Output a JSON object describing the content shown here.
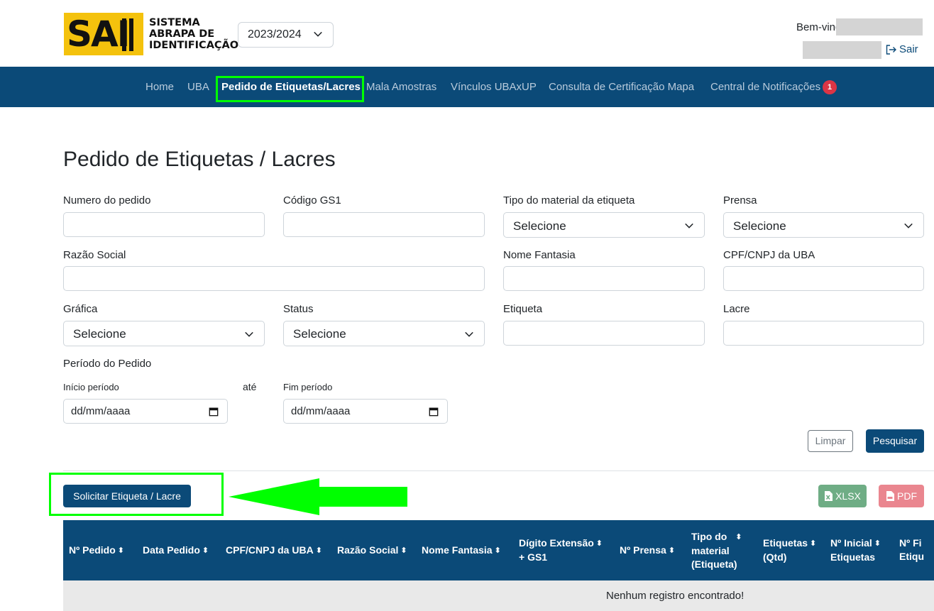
{
  "header": {
    "logo_letters": "SAI",
    "logo_line1": "SISTEMA",
    "logo_line2": "ABRAPA DE",
    "logo_line3": "IDENTIFICAÇÃO",
    "year_selected": "2023/2024",
    "welcome": "Bem-vindo",
    "logout": "Sair"
  },
  "nav": {
    "items": [
      "Home",
      "UBA",
      "Pedido de Etiquetas/Lacres",
      "Mala Amostras",
      "Vínculos UBAxUP",
      "Consulta de Certificação Mapa",
      "Central de Notificações"
    ],
    "notification_count": "1"
  },
  "page": {
    "title": "Pedido de Etiquetas / Lacres"
  },
  "form": {
    "numero_pedido": "Numero do pedido",
    "codigo_gs1": "Código GS1",
    "tipo_material": "Tipo do material da etiqueta",
    "prensa": "Prensa",
    "razao_social": "Razão Social",
    "nome_fantasia": "Nome Fantasia",
    "cpf_cnpj_uba": "CPF/CNPJ da UBA",
    "grafica": "Gráfica",
    "status": "Status",
    "etiqueta": "Etiqueta",
    "lacre": "Lacre",
    "periodo": "Período do Pedido",
    "inicio_periodo": "Início período",
    "ate": "até",
    "fim_periodo": "Fim período",
    "select_placeholder": "Selecione",
    "date_placeholder": "dd/mm/aaaa",
    "limpar": "Limpar",
    "pesquisar": "Pesquisar"
  },
  "actions": {
    "solicitar": "Solicitar Etiqueta / Lacre",
    "xlsx": "XLSX",
    "pdf": "PDF"
  },
  "table": {
    "columns": [
      [
        "Nº Pedido"
      ],
      [
        "Data Pedido"
      ],
      [
        "CPF/CNPJ da UBA"
      ],
      [
        "Razão Social"
      ],
      [
        "Nome Fantasia"
      ],
      [
        "Dígito Extensão",
        "+ GS1"
      ],
      [
        "Nº Prensa"
      ],
      [
        "Tipo do",
        "material",
        "(Etiqueta)"
      ],
      [
        "Etiquetas",
        "(Qtd)"
      ],
      [
        "Nº Inicial",
        "Etiquetas"
      ],
      [
        "Nº Fi",
        "Etiqu"
      ]
    ],
    "empty": "Nenhum registro encontrado!"
  },
  "colors": {
    "brand": "#0b4a78",
    "logo_yellow": "#f4c20d",
    "highlight": "#00ff00",
    "xlsx": "#6fad85",
    "pdf": "#ea868f",
    "badge": "#dc3545"
  }
}
